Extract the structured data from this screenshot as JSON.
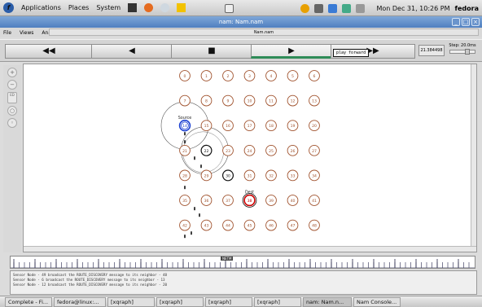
{
  "topbar": {
    "menus": [
      "Applications",
      "Places",
      "System"
    ],
    "clock": "Mon Dec 31, 10:26 PM",
    "user": "fedora"
  },
  "window": {
    "title": "nam: Nam.nam"
  },
  "menubar": {
    "items": [
      "File",
      "Views",
      "Analysis"
    ],
    "filename": "Nam.nam"
  },
  "controls": {
    "rewind_icon": "fast-rewind-icon",
    "back_icon": "back-icon",
    "stop_icon": "stop-icon",
    "play_icon": "play-icon",
    "ff_icon": "fast-forward-icon",
    "tooltip": "play forward",
    "time": "21.384498",
    "step": "Step: 20.0ms"
  },
  "nodes": [
    {
      "id": "0",
      "row": 0,
      "col": 0
    },
    {
      "id": "1",
      "row": 0,
      "col": 1
    },
    {
      "id": "2",
      "row": 0,
      "col": 2
    },
    {
      "id": "3",
      "row": 0,
      "col": 3
    },
    {
      "id": "4",
      "row": 0,
      "col": 4
    },
    {
      "id": "5",
      "row": 0,
      "col": 5
    },
    {
      "id": "6",
      "row": 0,
      "col": 6
    },
    {
      "id": "7",
      "row": 1,
      "col": 0
    },
    {
      "id": "8",
      "row": 1,
      "col": 1
    },
    {
      "id": "9",
      "row": 1,
      "col": 2
    },
    {
      "id": "10",
      "row": 1,
      "col": 3
    },
    {
      "id": "11",
      "row": 1,
      "col": 4
    },
    {
      "id": "12",
      "row": 1,
      "col": 5
    },
    {
      "id": "13",
      "row": 1,
      "col": 6
    },
    {
      "id": "14",
      "row": 2,
      "col": 0,
      "role": "source"
    },
    {
      "id": "15",
      "row": 2,
      "col": 1
    },
    {
      "id": "16",
      "row": 2,
      "col": 2
    },
    {
      "id": "17",
      "row": 2,
      "col": 3
    },
    {
      "id": "18",
      "row": 2,
      "col": 4
    },
    {
      "id": "19",
      "row": 2,
      "col": 5
    },
    {
      "id": "20",
      "row": 2,
      "col": 6
    },
    {
      "id": "21",
      "row": 3,
      "col": 0
    },
    {
      "id": "22",
      "row": 3,
      "col": 1,
      "role": "black"
    },
    {
      "id": "23",
      "row": 3,
      "col": 2
    },
    {
      "id": "24",
      "row": 3,
      "col": 3
    },
    {
      "id": "25",
      "row": 3,
      "col": 4
    },
    {
      "id": "26",
      "row": 3,
      "col": 5
    },
    {
      "id": "27",
      "row": 3,
      "col": 6
    },
    {
      "id": "28",
      "row": 4,
      "col": 0
    },
    {
      "id": "29",
      "row": 4,
      "col": 1
    },
    {
      "id": "30",
      "row": 4,
      "col": 2,
      "role": "black"
    },
    {
      "id": "31",
      "row": 4,
      "col": 3
    },
    {
      "id": "32",
      "row": 4,
      "col": 4
    },
    {
      "id": "33",
      "row": 4,
      "col": 5
    },
    {
      "id": "34",
      "row": 4,
      "col": 6
    },
    {
      "id": "35",
      "row": 5,
      "col": 0
    },
    {
      "id": "36",
      "row": 5,
      "col": 1
    },
    {
      "id": "37",
      "row": 5,
      "col": 2
    },
    {
      "id": "38",
      "row": 5,
      "col": 3,
      "role": "dest"
    },
    {
      "id": "39",
      "row": 5,
      "col": 4
    },
    {
      "id": "40",
      "row": 5,
      "col": 5
    },
    {
      "id": "41",
      "row": 5,
      "col": 6
    },
    {
      "id": "42",
      "row": 6,
      "col": 0
    },
    {
      "id": "43",
      "row": 6,
      "col": 1
    },
    {
      "id": "44",
      "row": 6,
      "col": 2
    },
    {
      "id": "45",
      "row": 6,
      "col": 3
    },
    {
      "id": "46",
      "row": 6,
      "col": 4
    },
    {
      "id": "47",
      "row": 6,
      "col": 5
    },
    {
      "id": "48",
      "row": 6,
      "col": 6
    }
  ],
  "labels": {
    "source": "Source",
    "dest": "Dest"
  },
  "timeline_marker": "NETM",
  "log": [
    "Sensor Node - 49 broadcast the ROUTE_DISCOVERY message to its neighbor - 48",
    "Sensor Node - 6 broadcast the ROUTE_DISCOVERY message to its neighbor - 13",
    "Sensor Node - 12 broadcast the ROUTE_DISCOVERY message to its neighbor - 20"
  ],
  "taskbar": [
    "Complete - Fi...",
    "fedora@linux:...",
    "[xqraph]",
    "[xqraph]",
    "[xqraph]",
    "[xqraph]",
    "nam: Nam.n...",
    "Nam Console..."
  ]
}
